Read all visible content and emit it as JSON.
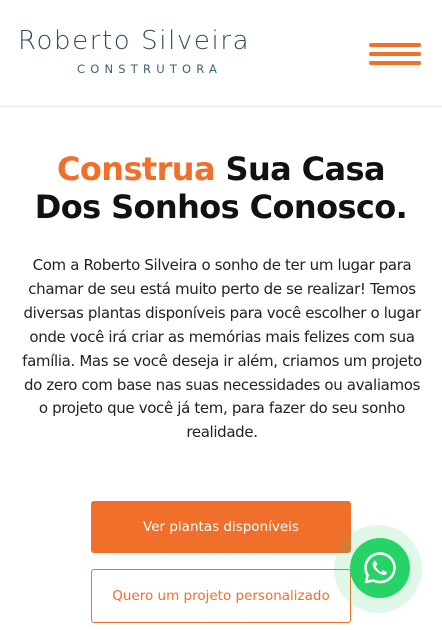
{
  "header": {
    "logo_name": "Roberto Silveira",
    "logo_subtitle": "CONSTRUTORA",
    "menu_icon": "hamburger-menu-icon"
  },
  "hero": {
    "title_accent": "Construa",
    "title_rest_line1": " Sua Casa",
    "title_line2": "Dos Sonhos Conosco.",
    "description": "Com a Roberto Silveira o sonho de ter um lugar para chamar de seu está muito perto de se realizar! Temos diversas plantas disponíveis para você escolher o lugar onde você irá criar as memórias mais felizes com sua família. Mas se você deseja ir além, criamos um projeto do zero com base nas suas necessidades ou avaliamos o projeto que você já tem, para fazer do seu sonho realidade.",
    "primary_button": "Ver plantas disponíveis",
    "secondary_button": "Quero um projeto personalizado"
  },
  "floating": {
    "whatsapp_icon": "whatsapp-icon"
  },
  "colors": {
    "accent": "#ef6f2b",
    "logo": "#2f4a5a",
    "whatsapp": "#25d366",
    "text": "#111111"
  }
}
